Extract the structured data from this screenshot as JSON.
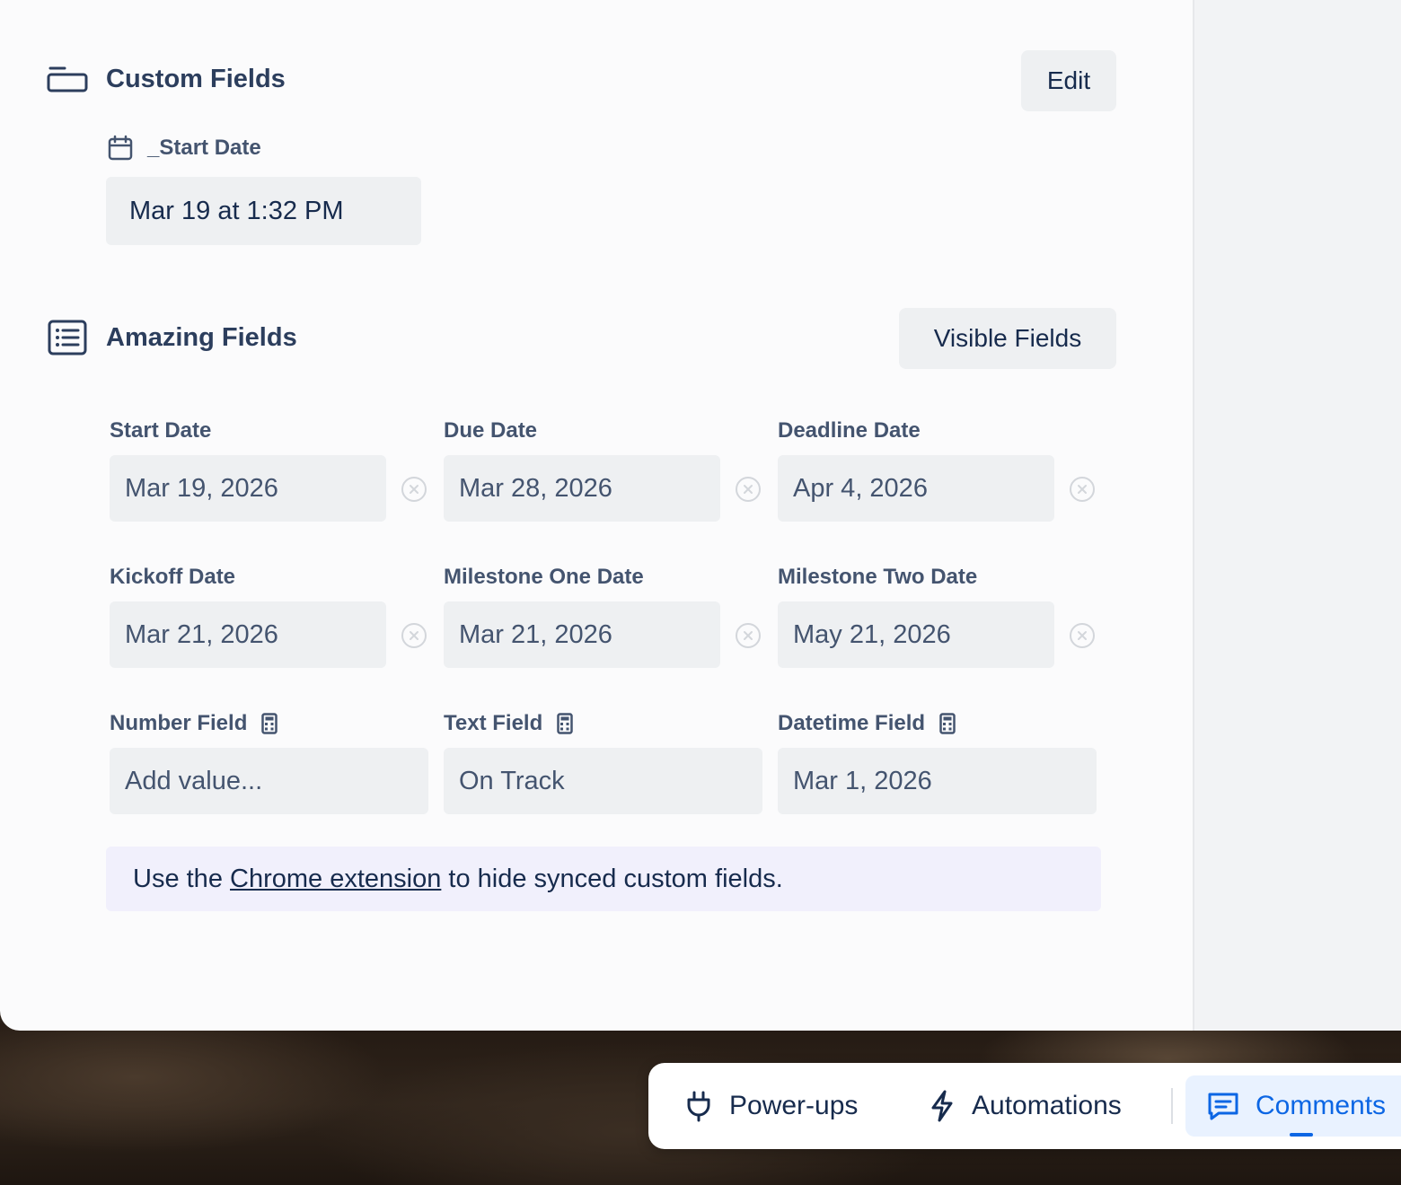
{
  "custom_fields": {
    "title": "Custom Fields",
    "edit_label": "Edit",
    "start_date": {
      "label": "_Start Date",
      "value": "Mar 19 at 1:32 PM"
    }
  },
  "amazing_fields": {
    "title": "Amazing Fields",
    "visible_fields_label": "Visible Fields",
    "fields": [
      {
        "label": "Start Date",
        "value": "Mar 19, 2026"
      },
      {
        "label": "Due Date",
        "value": "Mar 28, 2026"
      },
      {
        "label": "Deadline Date",
        "value": "Apr 4, 2026"
      },
      {
        "label": "Kickoff Date",
        "value": "Mar 21, 2026"
      },
      {
        "label": "Milestone One Date",
        "value": "Mar 21, 2026"
      },
      {
        "label": "Milestone Two Date",
        "value": "May 21, 2026"
      },
      {
        "label": "Number Field",
        "placeholder": "Add value..."
      },
      {
        "label": "Text Field",
        "value": "On Track"
      },
      {
        "label": "Datetime Field",
        "value": "Mar 1, 2026"
      }
    ],
    "banner": {
      "prefix": "Use the",
      "link": "Chrome extension",
      "suffix": "to hide synced custom fields."
    }
  },
  "bottom_bar": {
    "powerups_label": "Power-ups",
    "automations_label": "Automations",
    "comments_label": "Comments"
  },
  "colors": {
    "accent": "#0c66e4",
    "field_bg": "#eef0f2",
    "banner_bg": "#f1f0fc"
  },
  "icons": {
    "custom_fields": "card-icon",
    "start_date": "calendar-icon",
    "amazing_fields": "list-icon",
    "clear": "clear-circle-icon",
    "calculator": "calculator-icon",
    "powerups": "plug-icon",
    "automations": "bolt-icon",
    "comments": "comment-icon"
  }
}
